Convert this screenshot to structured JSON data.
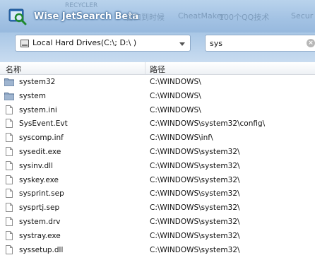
{
  "window": {
    "title": "Wise JetSearch Beta",
    "ghost_texts": [
      "RECYCLER",
      "窗口到时候",
      "CheatMaker",
      "100个QQ技术",
      "Secur"
    ]
  },
  "search": {
    "drive_label": "Local Hard Drives(C:\\; D:\\ )",
    "query": "sys"
  },
  "columns": {
    "name": "名称",
    "path": "路径"
  },
  "rows": [
    {
      "type": "folder",
      "name": "system32",
      "path": "C:\\WINDOWS\\"
    },
    {
      "type": "folder",
      "name": "system",
      "path": "C:\\WINDOWS\\"
    },
    {
      "type": "file",
      "name": "system.ini",
      "path": "C:\\WINDOWS\\"
    },
    {
      "type": "file",
      "name": "SysEvent.Evt",
      "path": "C:\\WINDOWS\\system32\\config\\"
    },
    {
      "type": "file",
      "name": "syscomp.inf",
      "path": "C:\\WINDOWS\\inf\\"
    },
    {
      "type": "file",
      "name": "sysedit.exe",
      "path": "C:\\WINDOWS\\system32\\"
    },
    {
      "type": "file",
      "name": "sysinv.dll",
      "path": "C:\\WINDOWS\\system32\\"
    },
    {
      "type": "file",
      "name": "syskey.exe",
      "path": "C:\\WINDOWS\\system32\\"
    },
    {
      "type": "file",
      "name": "sysprint.sep",
      "path": "C:\\WINDOWS\\system32\\"
    },
    {
      "type": "file",
      "name": "sysprtj.sep",
      "path": "C:\\WINDOWS\\system32\\"
    },
    {
      "type": "file",
      "name": "system.drv",
      "path": "C:\\WINDOWS\\system32\\"
    },
    {
      "type": "file",
      "name": "systray.exe",
      "path": "C:\\WINDOWS\\system32\\"
    },
    {
      "type": "file",
      "name": "syssetup.dll",
      "path": "C:\\WINDOWS\\system32\\"
    }
  ],
  "icons": {
    "app": "magnifier-icon",
    "drive": "hard-drive-icon",
    "clear": "clear-search-icon",
    "folder": "folder-icon",
    "file": "file-icon"
  },
  "colors": {
    "title_bar": "#a4c3e4",
    "folder_icon": "#7d96b5"
  }
}
